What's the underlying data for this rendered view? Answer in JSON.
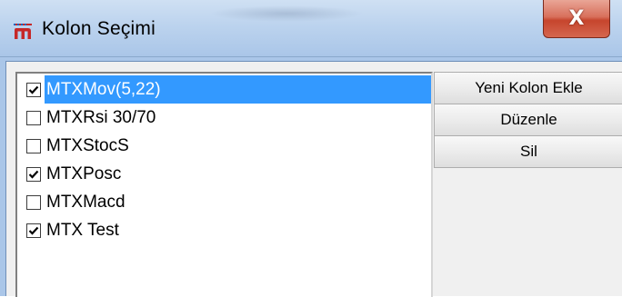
{
  "window": {
    "title": "Kolon Seçimi",
    "close_glyph": "X",
    "app_icon": "m-logo-icon"
  },
  "list": {
    "items": [
      {
        "label": "MTXMov(5,22)",
        "checked": true,
        "selected": true
      },
      {
        "label": "MTXRsi 30/70",
        "checked": false,
        "selected": false
      },
      {
        "label": "MTXStocS",
        "checked": false,
        "selected": false
      },
      {
        "label": "MTXPosc",
        "checked": true,
        "selected": false
      },
      {
        "label": "MTXMacd",
        "checked": false,
        "selected": false
      },
      {
        "label": "MTX Test",
        "checked": true,
        "selected": false
      }
    ]
  },
  "buttons": {
    "add_column": "Yeni Kolon Ekle",
    "edit": "Düzenle",
    "delete": "Sil"
  },
  "colors": {
    "selection": "#3399ff",
    "titlebar": "#bcd3ee",
    "close": "#c6452d"
  }
}
